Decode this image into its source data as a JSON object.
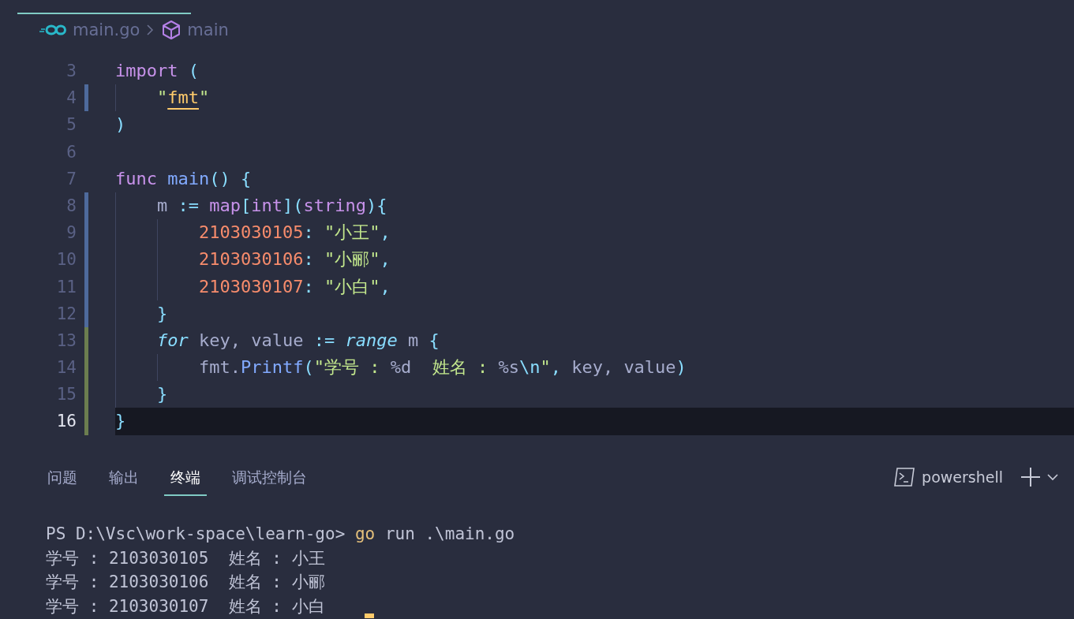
{
  "breadcrumb": {
    "file": "main.go",
    "symbol": "main"
  },
  "lines": [
    {
      "n": "3",
      "modified": false,
      "added": false,
      "current": false,
      "tokens": [
        {
          "kind": "keyword",
          "t": "import "
        },
        {
          "kind": "punct",
          "t": "("
        }
      ]
    },
    {
      "n": "4",
      "modified": true,
      "added": false,
      "current": false,
      "tokens": [
        {
          "kind": "string",
          "t": "    \""
        },
        {
          "kind": "package",
          "t": "fmt"
        },
        {
          "kind": "string",
          "t": "\""
        }
      ]
    },
    {
      "n": "5",
      "modified": false,
      "added": false,
      "current": false,
      "tokens": [
        {
          "kind": "punct",
          "t": ")"
        }
      ]
    },
    {
      "n": "6",
      "modified": false,
      "added": false,
      "current": false
    },
    {
      "n": "7",
      "modified": false,
      "added": false,
      "current": false,
      "tokens": [
        {
          "kind": "keyword",
          "t": "func "
        },
        {
          "kind": "function",
          "t": "main"
        },
        {
          "kind": "punct",
          "t": "() {"
        }
      ]
    },
    {
      "n": "8",
      "modified": true,
      "added": false,
      "current": false,
      "tokens": [
        {
          "kind": "plain",
          "t": "    m "
        },
        {
          "kind": "punct",
          "t": ":= "
        },
        {
          "kind": "keyword",
          "t": "map"
        },
        {
          "kind": "punct",
          "t": "["
        },
        {
          "kind": "keyword",
          "t": "int"
        },
        {
          "kind": "punct",
          "t": "]("
        },
        {
          "kind": "keyword",
          "t": "string"
        },
        {
          "kind": "punct",
          "t": "){"
        }
      ]
    },
    {
      "n": "9",
      "modified": true,
      "added": false,
      "current": false,
      "tokens": [
        {
          "kind": "number",
          "t": "        2103030105"
        },
        {
          "kind": "punct",
          "t": ": "
        },
        {
          "kind": "string",
          "t": "\"小王\""
        },
        {
          "kind": "punct",
          "t": ","
        }
      ]
    },
    {
      "n": "10",
      "modified": true,
      "added": false,
      "current": false,
      "tokens": [
        {
          "kind": "number",
          "t": "        2103030106"
        },
        {
          "kind": "punct",
          "t": ": "
        },
        {
          "kind": "string",
          "t": "\"小郦\""
        },
        {
          "kind": "punct",
          "t": ","
        }
      ]
    },
    {
      "n": "11",
      "modified": true,
      "added": false,
      "current": false,
      "tokens": [
        {
          "kind": "number",
          "t": "        2103030107"
        },
        {
          "kind": "punct",
          "t": ": "
        },
        {
          "kind": "string",
          "t": "\"小白\""
        },
        {
          "kind": "punct",
          "t": ","
        }
      ]
    },
    {
      "n": "12",
      "modified": true,
      "added": false,
      "current": false,
      "tokens": [
        {
          "kind": "punct",
          "t": "    }"
        }
      ]
    },
    {
      "n": "13",
      "modified": false,
      "added": true,
      "current": false,
      "tokens": [
        {
          "kind": "control",
          "t": "    for"
        },
        {
          "kind": "plain",
          "t": " key, value "
        },
        {
          "kind": "punct",
          "t": ":= "
        },
        {
          "kind": "control",
          "t": "range"
        },
        {
          "kind": "plain",
          "t": " m "
        },
        {
          "kind": "punct",
          "t": "{"
        }
      ]
    },
    {
      "n": "14",
      "modified": false,
      "added": true,
      "current": false,
      "tokens": [
        {
          "kind": "plain",
          "t": "        fmt."
        },
        {
          "kind": "function",
          "t": "Printf"
        },
        {
          "kind": "punct",
          "t": "("
        },
        {
          "kind": "string",
          "t": "\"学号 : "
        },
        {
          "kind": "plain",
          "t": "%d"
        },
        {
          "kind": "string",
          "t": "  姓名 : "
        },
        {
          "kind": "plain",
          "t": "%s"
        },
        {
          "kind": "escape",
          "t": "\\n"
        },
        {
          "kind": "string",
          "t": "\""
        },
        {
          "kind": "punct",
          "t": ","
        },
        {
          "kind": "plain",
          "t": " key, value"
        },
        {
          "kind": "punct",
          "t": ")"
        }
      ]
    },
    {
      "n": "15",
      "modified": false,
      "added": true,
      "current": false,
      "tokens": [
        {
          "kind": "punct",
          "t": "    }"
        }
      ]
    },
    {
      "n": "16",
      "modified": false,
      "added": true,
      "current": true,
      "tokens": [
        {
          "kind": "punct",
          "t": "}"
        }
      ]
    }
  ],
  "panel_tabs": [
    {
      "label": "问题",
      "selected": false
    },
    {
      "label": "输出",
      "selected": false
    },
    {
      "label": "终端",
      "selected": true
    },
    {
      "label": "调试控制台",
      "selected": false
    }
  ],
  "terminal_name": "powershell",
  "terminal_lines": [
    [
      {
        "kind": "plain",
        "t": "PS D:\\Vsc\\work-space\\learn-go> "
      },
      {
        "kind": "command",
        "t": "go"
      },
      {
        "kind": "plain",
        "t": " run .\\main.go"
      }
    ],
    [
      {
        "kind": "plain",
        "t": "学号 : 2103030105  姓名 : 小王"
      }
    ],
    [
      {
        "kind": "plain",
        "t": "学号 : 2103030106  姓名 : 小郦"
      }
    ],
    [
      {
        "kind": "plain",
        "t": "学号 : 2103030107  姓名 : 小白"
      }
    ]
  ]
}
